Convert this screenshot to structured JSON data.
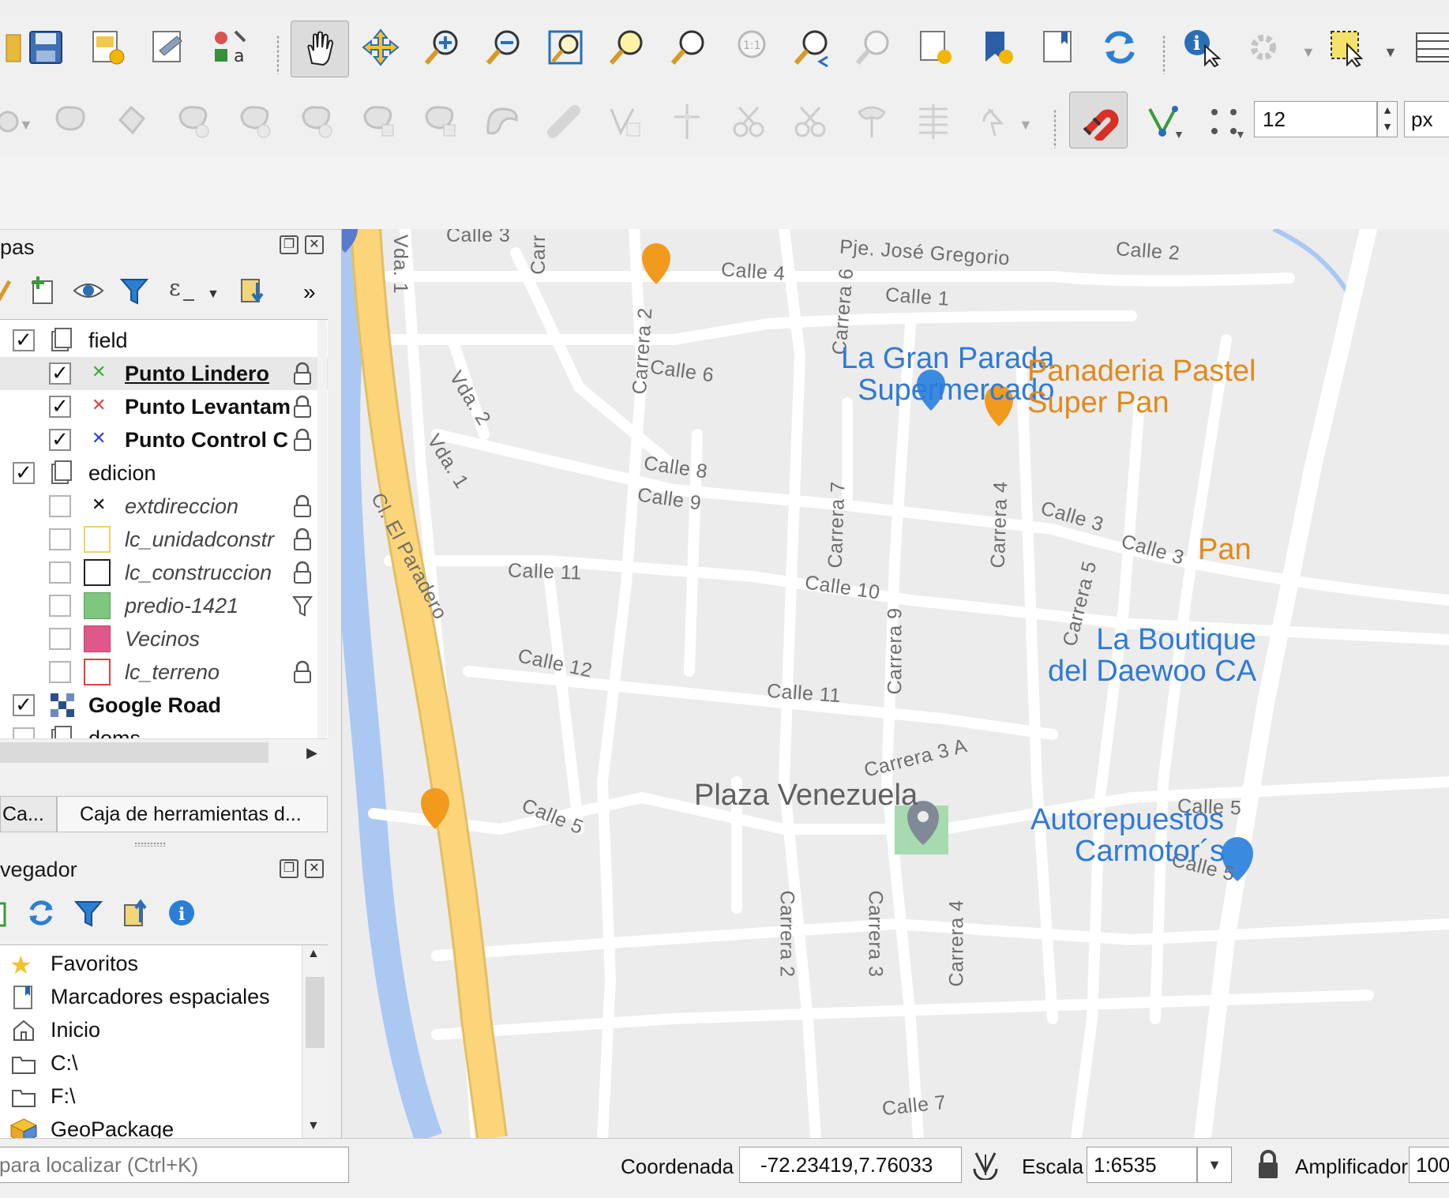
{
  "toolbar": {
    "snap_tolerance_value": "12",
    "snap_unit": "px"
  },
  "layers_panel": {
    "title": "pas",
    "items": [
      {
        "label": "field",
        "checked": true
      },
      {
        "label": "Punto Lindero",
        "checked": true
      },
      {
        "label": "Punto Levantam",
        "checked": true
      },
      {
        "label": "Punto Control C",
        "checked": true
      },
      {
        "label": "edicion",
        "checked": true
      },
      {
        "label": "extdireccion",
        "checked": false
      },
      {
        "label": "lc_unidadconstr",
        "checked": false
      },
      {
        "label": "lc_construccion",
        "checked": false
      },
      {
        "label": "predio-1421",
        "checked": false
      },
      {
        "label": "Vecinos",
        "checked": false
      },
      {
        "label": "lc_terreno",
        "checked": false
      },
      {
        "label": "Google Road",
        "checked": true
      },
      {
        "label": "doms",
        "checked": false
      }
    ],
    "more": "»"
  },
  "tabs": {
    "left": "Ca...",
    "right": "Caja de herramientas d..."
  },
  "browser_panel": {
    "title": "vegador",
    "items": [
      {
        "label": "Favoritos"
      },
      {
        "label": "Marcadores espaciales"
      },
      {
        "label": "Inicio"
      },
      {
        "label": "C:\\"
      },
      {
        "label": "F:\\"
      },
      {
        "label": "GeoPackage"
      }
    ]
  },
  "map": {
    "streets": [
      "Calle 3",
      "Calle 4",
      "Carrera 6",
      "Pje. José Gregorio",
      "Calle 1",
      "Calle 2",
      "Vda. 1",
      "Carrera 2",
      "Calle 6",
      "Vda. 2",
      "Vda. 1",
      "Calle 8",
      "Calle 9",
      "Carrera 7",
      "Calle 3",
      "Calle 3",
      "Cl. El Paradero",
      "Calle 11",
      "Calle 10",
      "Carrera 4",
      "Carrera 5",
      "Carrera 9",
      "Calle 12",
      "Calle 11",
      "Carrera 3 A",
      "Calle 5",
      "Calle 5",
      "Calle 5",
      "Carrera 2",
      "Carrera 3",
      "Carrera 4",
      "Calle 7",
      "Carr"
    ],
    "places": {
      "supermarket": [
        "La Gran Parada",
        "Supermercado"
      ],
      "bakery": [
        "Panaderia Pastel",
        "Super Pan"
      ],
      "pan_partial": "Pan",
      "boutique": [
        "La Boutique",
        "del Daewoo CA"
      ],
      "plaza": "Plaza Venezuela",
      "autorepuestos": [
        "Autorepuestos",
        "Carmotor´s"
      ]
    },
    "colors": {
      "highway": "#fcd57a",
      "river": "#aac8f2",
      "road": "#ffffff",
      "park": "#a8dab0",
      "poi_blue": "#2f7ad6",
      "poi_orange": "#e08a1e"
    }
  },
  "statusbar": {
    "locator_placeholder": "para localizar (Ctrl+K)",
    "coord_label": "Coordenada",
    "coord_value": "-72.23419,7.76033",
    "scale_label": "Escala",
    "scale_value": "1:6535",
    "magnifier_label": "Amplificador",
    "magnifier_value": "100"
  }
}
